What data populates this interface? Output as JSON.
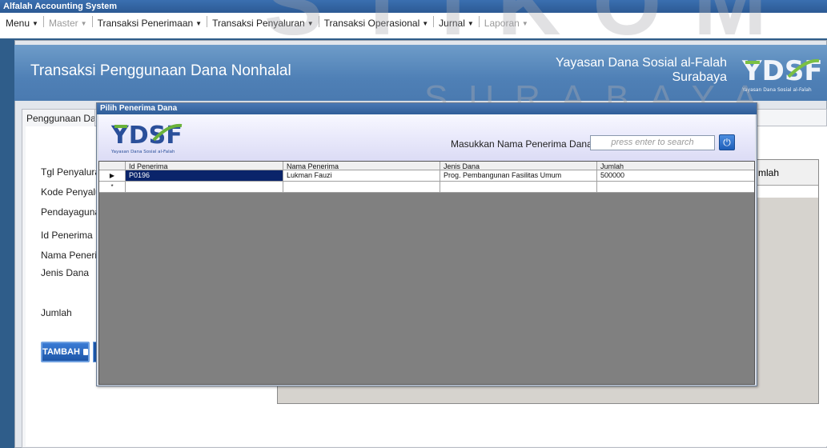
{
  "window": {
    "title": "Alfalah Accounting System"
  },
  "menu": {
    "items": [
      {
        "label": "Menu",
        "disabled": false
      },
      {
        "label": "Master",
        "disabled": true
      },
      {
        "label": "Transaksi Penerimaan",
        "disabled": false
      },
      {
        "label": "Transaksi Penyaluran",
        "disabled": false
      },
      {
        "label": "Transaksi Operasional",
        "disabled": false
      },
      {
        "label": "Jurnal",
        "disabled": false
      },
      {
        "label": "Laporan",
        "disabled": true
      }
    ]
  },
  "header": {
    "title": "Transaksi Penggunaan Dana Nonhalal",
    "org_line1": "Yayasan Dana Sosial al-Falah",
    "org_line2": "Surabaya",
    "logo_text": "YDSF",
    "logo_caption": "Yayasan Dana Sosial al-Falah"
  },
  "watermark": {
    "line1": "STIKOM",
    "line2": "SURABAYA"
  },
  "form": {
    "tab_label": "Penggunaan Dana",
    "labels": {
      "tgl": "Tgl Penyaluran",
      "kode": "Kode Penyaluran",
      "pendayagunaan": "Pendayagunaan",
      "id_penerima": "Id Penerima",
      "nama_penerima": "Nama Penerima",
      "jenis_dana": "Jenis Dana",
      "jumlah": "Jumlah"
    },
    "right_table_header": "mlah",
    "tambah_label": "TAMBAH"
  },
  "dialog": {
    "title": "Pilih Penerima Dana",
    "search_label": "Masukkan Nama Penerima Dana",
    "search_placeholder": "press enter to search",
    "columns": [
      "Id Penerima",
      "Nama Penerima",
      "Jenis Dana",
      "Jumlah"
    ],
    "rows": [
      {
        "id": "P0196",
        "nama": "Lukman Fauzi",
        "jenis": "Prog. Pembangunan Fasilitas Umum",
        "jumlah": "500000"
      }
    ],
    "new_row_marker": "*"
  }
}
